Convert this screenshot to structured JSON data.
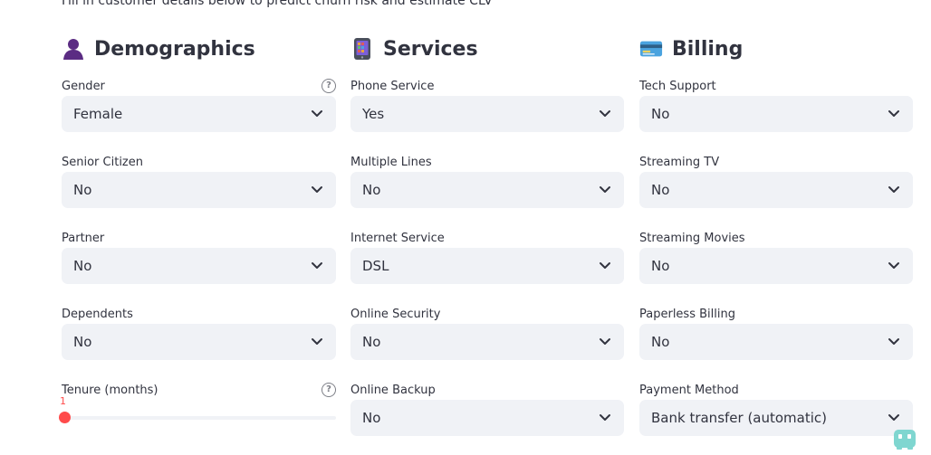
{
  "subtitle": "Fill in customer details below to predict churn risk and estimate CLV",
  "sections": {
    "demographics": {
      "title": "Demographics",
      "icon": "person-silhouette-icon",
      "fields": {
        "gender": {
          "label": "Gender",
          "value": "Female",
          "help": "?"
        },
        "senior_citizen": {
          "label": "Senior Citizen",
          "value": "No"
        },
        "partner": {
          "label": "Partner",
          "value": "No"
        },
        "dependents": {
          "label": "Dependents",
          "value": "No"
        },
        "tenure": {
          "label": "Tenure (months)",
          "value": "1",
          "help": "?",
          "fill_fraction": 0
        }
      }
    },
    "services": {
      "title": "Services",
      "icon": "mobile-phone-icon",
      "fields": {
        "phone_service": {
          "label": "Phone Service",
          "value": "Yes"
        },
        "multiple_lines": {
          "label": "Multiple Lines",
          "value": "No"
        },
        "internet_service": {
          "label": "Internet Service",
          "value": "DSL"
        },
        "online_security": {
          "label": "Online Security",
          "value": "No"
        },
        "online_backup": {
          "label": "Online Backup",
          "value": "No"
        }
      }
    },
    "billing": {
      "title": "Billing",
      "icon": "credit-card-icon",
      "fields": {
        "tech_support": {
          "label": "Tech Support",
          "value": "No"
        },
        "streaming_tv": {
          "label": "Streaming TV",
          "value": "No"
        },
        "streaming_movies": {
          "label": "Streaming Movies",
          "value": "No"
        },
        "paperless_billing": {
          "label": "Paperless Billing",
          "value": "No"
        },
        "payment_method": {
          "label": "Payment Method",
          "value": "Bank transfer (automatic)"
        }
      }
    }
  },
  "colors": {
    "accent": "#ff4b4b",
    "select_bg": "#f0f2f6",
    "text": "#31333f"
  }
}
